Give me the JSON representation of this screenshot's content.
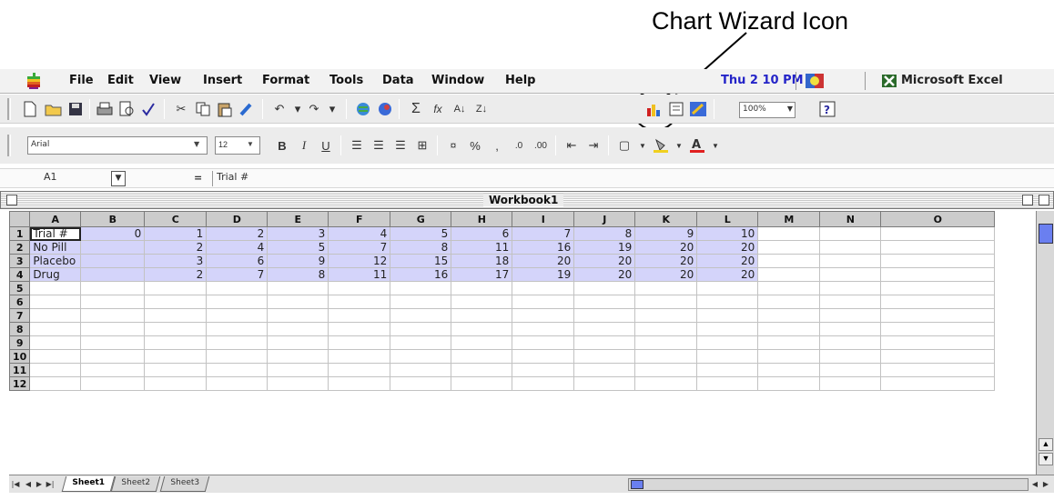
{
  "annotation": {
    "callout_text": "Chart Wizard Icon"
  },
  "menubar": {
    "items": [
      "File",
      "Edit",
      "View",
      "Insert",
      "Format",
      "Tools",
      "Data",
      "Window",
      "Help"
    ],
    "clock": "Thu 2 10 PM",
    "app_name": "Microsoft Excel"
  },
  "toolbar": {
    "zoom": "100%",
    "font": "Arial",
    "font_size": "12"
  },
  "formula_bar": {
    "cell_ref": "A1",
    "equals": "=",
    "value": "Trial #"
  },
  "workbook": {
    "title": "Workbook1"
  },
  "grid": {
    "columns": [
      "A",
      "B",
      "C",
      "D",
      "E",
      "F",
      "G",
      "H",
      "I",
      "J",
      "K",
      "L",
      "M",
      "N",
      "O"
    ],
    "rows": [
      [
        "Trial #",
        "0",
        "1",
        "2",
        "3",
        "4",
        "5",
        "6",
        "7",
        "8",
        "9",
        "10"
      ],
      [
        "No Pill",
        "",
        "2",
        "4",
        "5",
        "7",
        "8",
        "11",
        "16",
        "19",
        "20",
        "20"
      ],
      [
        "Placebo",
        "",
        "3",
        "6",
        "9",
        "12",
        "15",
        "18",
        "20",
        "20",
        "20",
        "20"
      ],
      [
        "Drug",
        "",
        "2",
        "7",
        "8",
        "11",
        "16",
        "17",
        "19",
        "20",
        "20",
        "20"
      ]
    ],
    "row_numbers": [
      "1",
      "2",
      "3",
      "4",
      "5",
      "6",
      "7",
      "8",
      "9",
      "10",
      "11",
      "12"
    ]
  },
  "sheet_tabs": [
    "Sheet1",
    "Sheet2",
    "Sheet3"
  ],
  "colors": {
    "selection": "#d4d4fa",
    "clock": "#2424c8",
    "scroll_thumb": "#6a7ff0"
  }
}
